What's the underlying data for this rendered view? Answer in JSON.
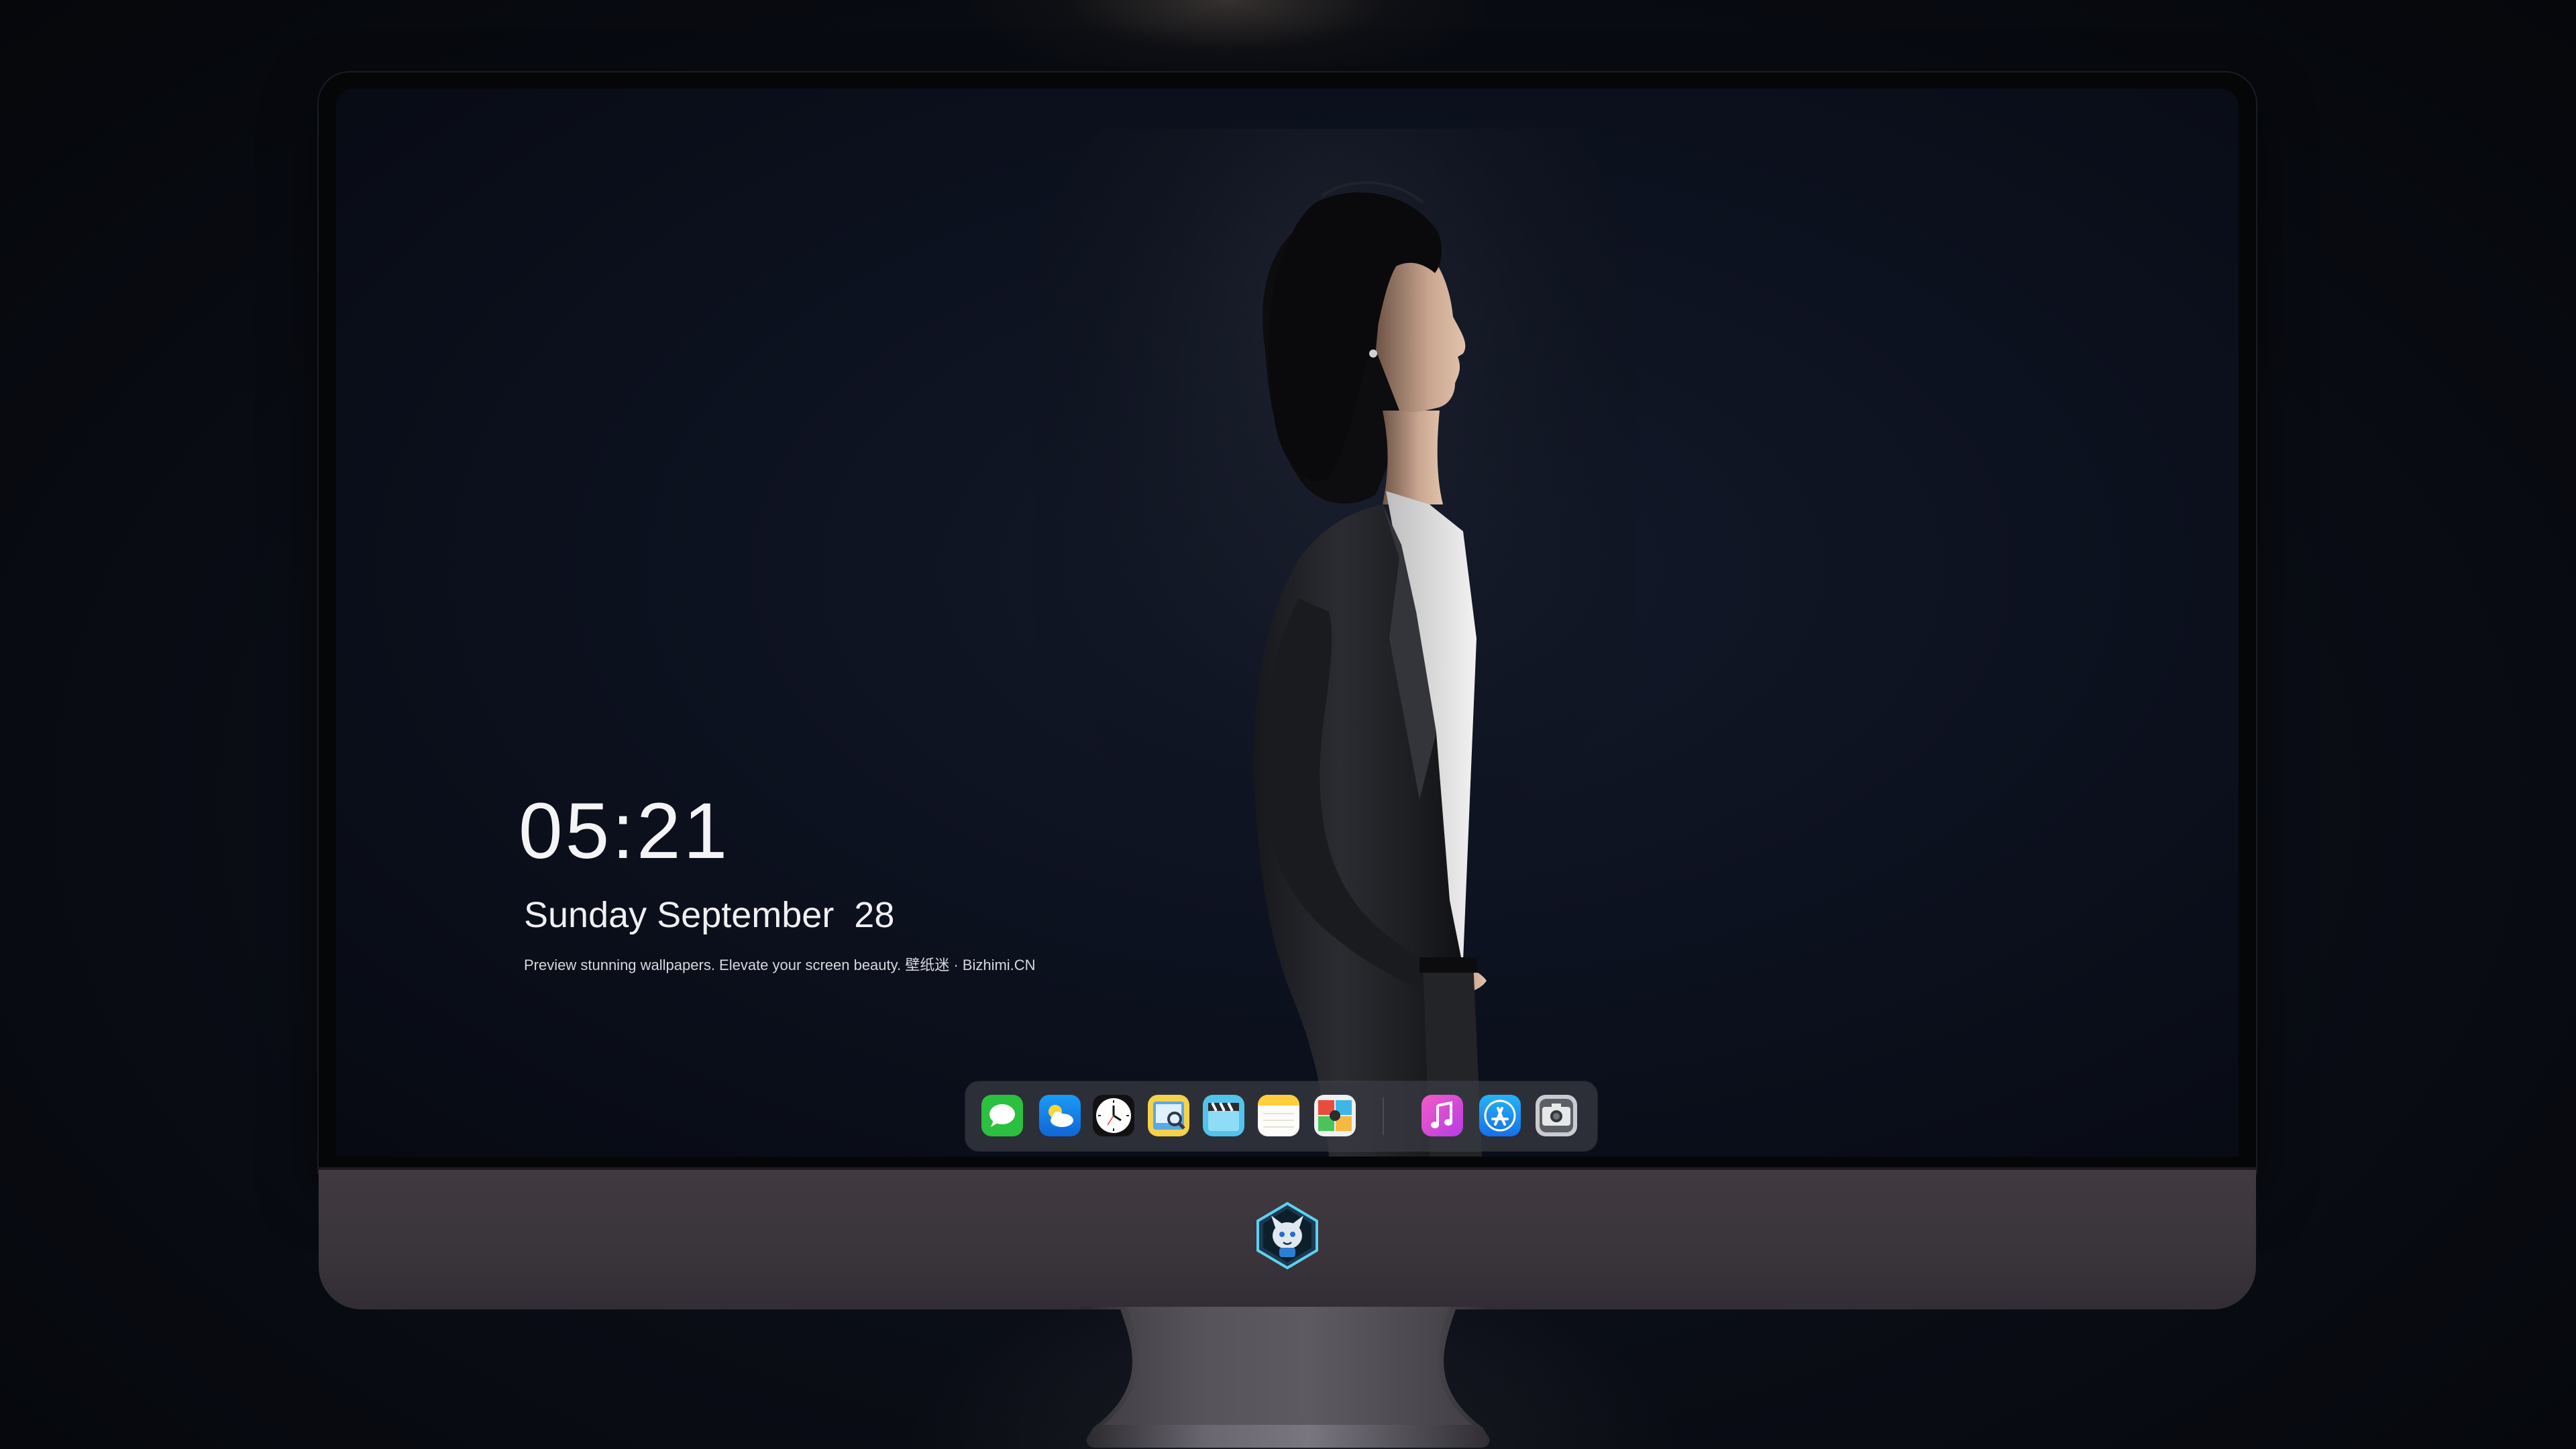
{
  "lockscreen": {
    "time": "05:21",
    "date": "Sunday September  28",
    "tagline": "Preview stunning wallpapers. Elevate your screen beauty. 壁纸迷 · Bizhimi.CN"
  },
  "dock": {
    "apps": [
      {
        "name": "messages",
        "icon": "messages-icon",
        "color": "#2ecc40"
      },
      {
        "name": "weather",
        "icon": "weather-icon",
        "color": "#1e90ff"
      },
      {
        "name": "clock",
        "icon": "clock-icon",
        "color": "#ffffff"
      },
      {
        "name": "preview",
        "icon": "preview-icon",
        "color": "#f2c744"
      },
      {
        "name": "clips",
        "icon": "clips-icon",
        "color": "#4fc3e8"
      },
      {
        "name": "notes",
        "icon": "notes-icon",
        "color": "#ffd24a"
      },
      {
        "name": "photo-booth",
        "icon": "photo-booth-icon",
        "color": "#e84c3d"
      },
      {
        "name": "music",
        "icon": "music-icon",
        "color": "#e03fd8"
      },
      {
        "name": "app-store",
        "icon": "app-store-icon",
        "color": "#1e8ef5"
      },
      {
        "name": "camera",
        "icon": "camera-icon",
        "color": "#6b6e75"
      }
    ]
  },
  "monitor": {
    "chin_logo": "mascot-logo"
  }
}
